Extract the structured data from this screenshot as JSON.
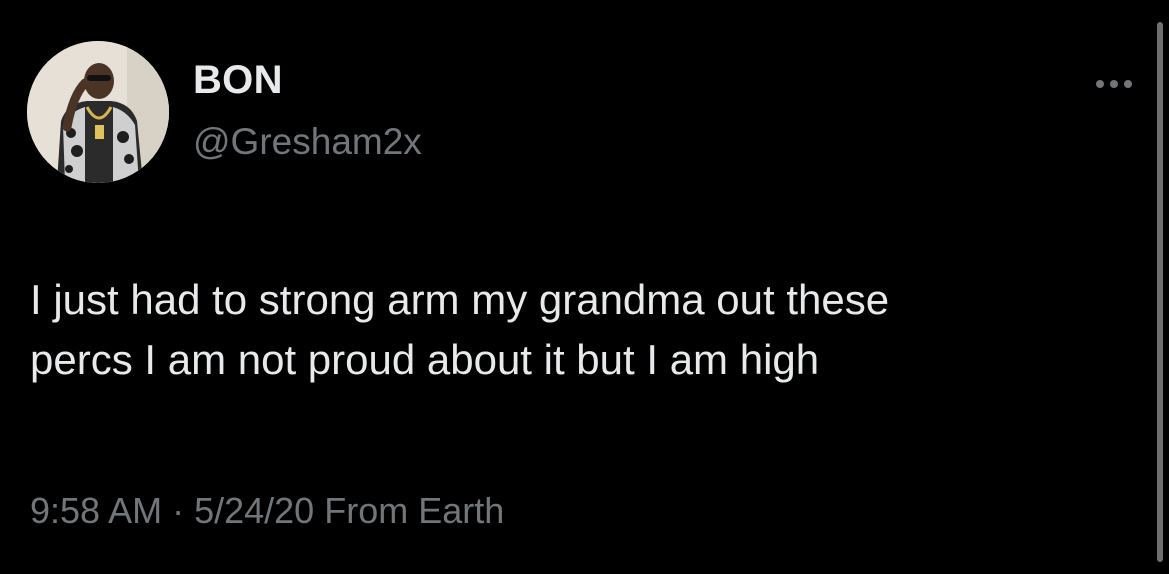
{
  "tweet": {
    "display_name": "BON",
    "handle": "@Gresham2x",
    "text_lines": [
      "I just had to strong arm my grandma out these",
      "percs I am not proud about it but I am high"
    ],
    "time": "9:58 AM",
    "separator": "·",
    "date": "5/24/20",
    "source": "From Earth"
  },
  "icons": {
    "avatar": "profile-photo",
    "more": "more-horizontal-icon"
  },
  "colors": {
    "background": "#000000",
    "primary_text": "#e7e9ea",
    "secondary_text": "#71767b"
  }
}
